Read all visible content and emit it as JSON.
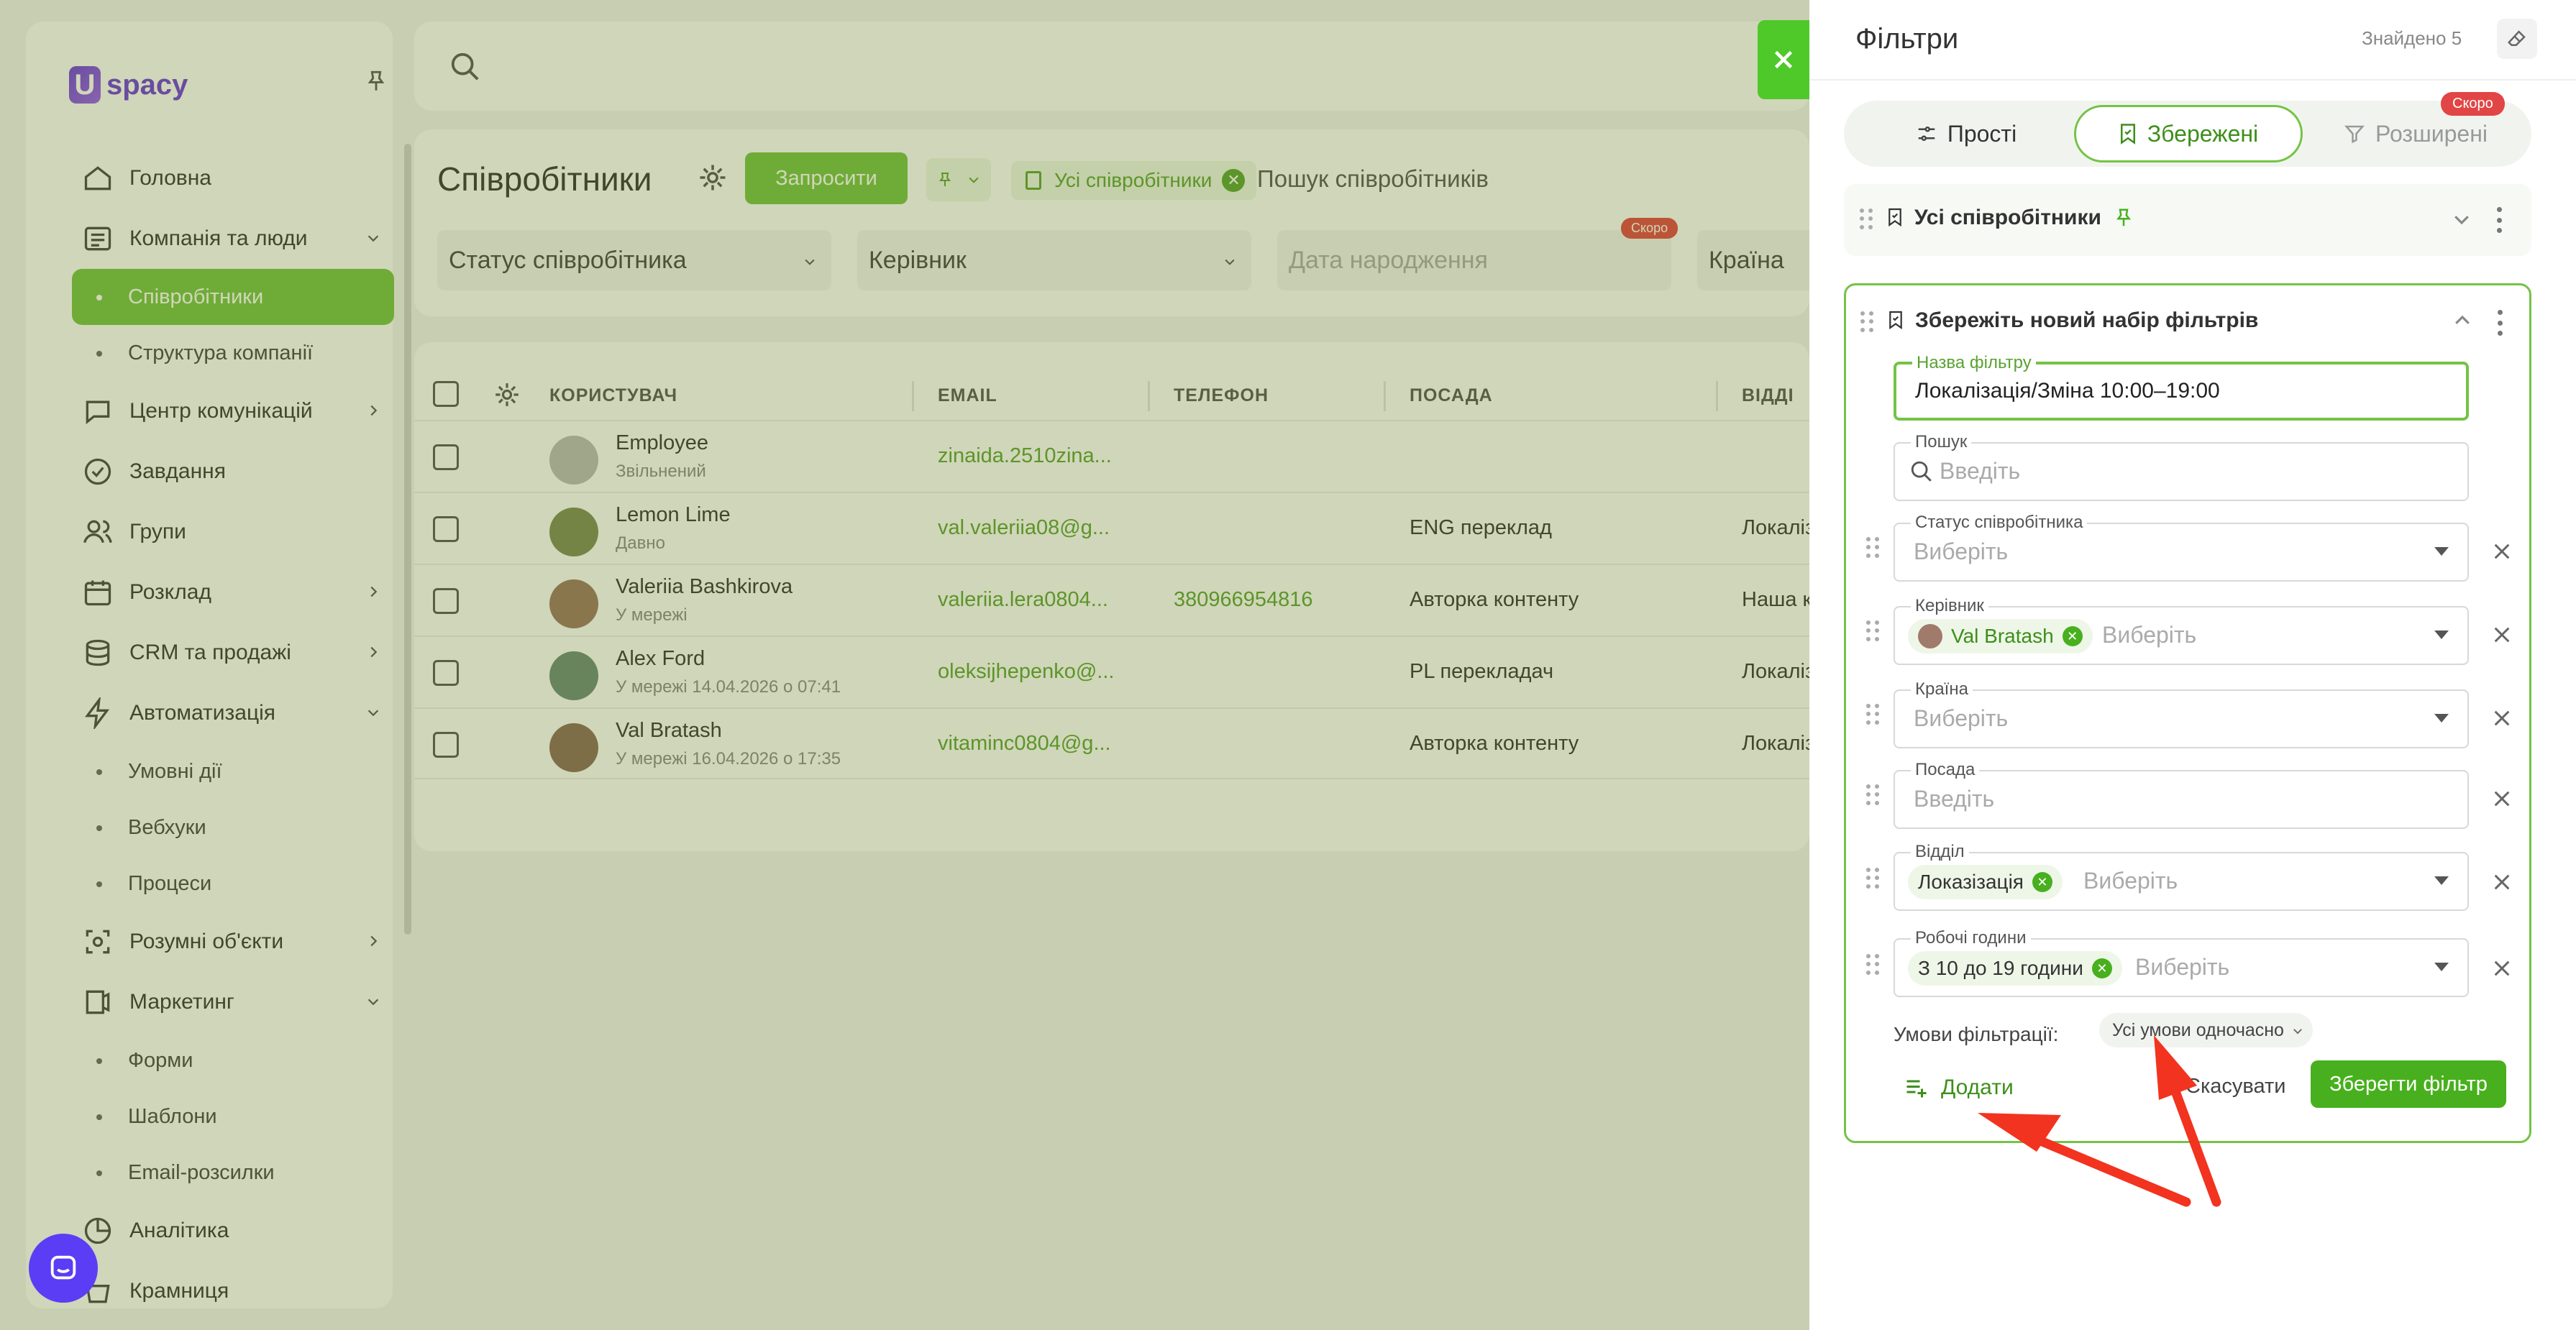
{
  "app": {
    "logo_text": "spacy",
    "sidebar": {
      "items": [
        {
          "label": "Головна",
          "icon": "home-icon"
        },
        {
          "label": "Компанія та люди",
          "icon": "company-icon",
          "expanded": true,
          "children": [
            {
              "label": "Співробітники",
              "active": true
            },
            {
              "label": "Структура компанії"
            }
          ]
        },
        {
          "label": "Центр комунікацій",
          "icon": "chat-icon"
        },
        {
          "label": "Завдання",
          "icon": "check-circle-icon"
        },
        {
          "label": "Групи",
          "icon": "users-icon"
        },
        {
          "label": "Розклад",
          "icon": "calendar-icon"
        },
        {
          "label": "CRM та продажі",
          "icon": "database-icon"
        },
        {
          "label": "Автоматизація",
          "icon": "lightning-icon",
          "expanded": true,
          "children": [
            {
              "label": "Умовні дії"
            },
            {
              "label": "Вебхуки"
            },
            {
              "label": "Процеси"
            }
          ]
        },
        {
          "label": "Розумні об'єкти",
          "icon": "smart-object-icon"
        },
        {
          "label": "Маркетинг",
          "icon": "marketing-icon",
          "expanded": true,
          "children": [
            {
              "label": "Форми"
            },
            {
              "label": "Шаблони"
            },
            {
              "label": "Email-розсилки"
            }
          ]
        },
        {
          "label": "Аналітика",
          "icon": "analytics-icon"
        },
        {
          "label": "Крамниця",
          "icon": "shop-icon"
        }
      ]
    },
    "employees": {
      "title": "Співробітники",
      "invite_label": "Запросити",
      "saved_chip": "Усі співробітники",
      "search_placeholder": "Пошук співробітників",
      "filters": {
        "status": "Статус співробітника",
        "manager": "Керівник",
        "birthday": "Дата народження",
        "country": "Країна",
        "soon": "Скоро"
      },
      "table": {
        "headers": [
          "КОРИСТУВАЧ",
          "EMAIL",
          "ТЕЛЕФОН",
          "ПОСАДА",
          "ВІДДІ"
        ],
        "rows": [
          {
            "name": "Employee",
            "status": "Звільнений",
            "email": "zinaida.2510zina...",
            "phone": "",
            "position": "",
            "department": ""
          },
          {
            "name": "Lemon Lime",
            "status": "Давно",
            "email": "val.valeriia08@g...",
            "phone": "",
            "position": "ENG переклад",
            "department": "Локалізація"
          },
          {
            "name": "Valeriia Bashkirova",
            "status": "У мережі",
            "email": "valeriia.lera0804...",
            "phone": "380966954816",
            "position": "Авторка контенту",
            "department": "Наша к"
          },
          {
            "name": "Alex Ford",
            "status": "У мережі 14.04.2026 о 07:41",
            "email": "oleksijhepenko@...",
            "phone": "",
            "position": "PL перекладач",
            "department": "Локалізація"
          },
          {
            "name": "Val Bratash",
            "status": "У мережі 16.04.2026 о 17:35",
            "email": "vitaminc0804@g...",
            "phone": "",
            "position": "Авторка контенту",
            "department": "Локалізація"
          }
        ]
      }
    }
  },
  "drawer": {
    "title": "Фільтри",
    "found": "Знайдено 5",
    "tabs": {
      "simple": "Прості",
      "saved": "Збережені",
      "advanced": "Розширені",
      "soon": "Скоро"
    },
    "collapsed_set": {
      "name": "Усі співробітники"
    },
    "new_set": {
      "name": "Збережіть новий набір фільтрів",
      "filter_name_label": "Назва фільтру",
      "filter_name_value": "Локалізація/Зміна 10:00–19:00",
      "search_label": "Пошук",
      "search_placeholder": "Введіть",
      "status_label": "Статус співробітника",
      "select_placeholder": "Виберіть",
      "manager_label": "Керівник",
      "manager_chip": "Val Bratash",
      "country_label": "Країна",
      "position_label": "Посада",
      "position_placeholder": "Введіть",
      "department_label": "Відділ",
      "department_chip": "Локазізація",
      "hours_label": "Робочі години",
      "hours_chip": "З 10 до 19 години",
      "conditions_label": "Умови фільтрації:",
      "conditions_value": "Усі умови одночасно",
      "add_label": "Додати",
      "cancel_label": "Скасувати",
      "save_label": "Зберегти фільтр"
    }
  },
  "colors": {
    "accent": "#74c346",
    "accent_dark": "#48b01e",
    "brand": "#6c3bdc",
    "annotation_arrow": "#f2331f",
    "badge_red": "#e24545"
  }
}
